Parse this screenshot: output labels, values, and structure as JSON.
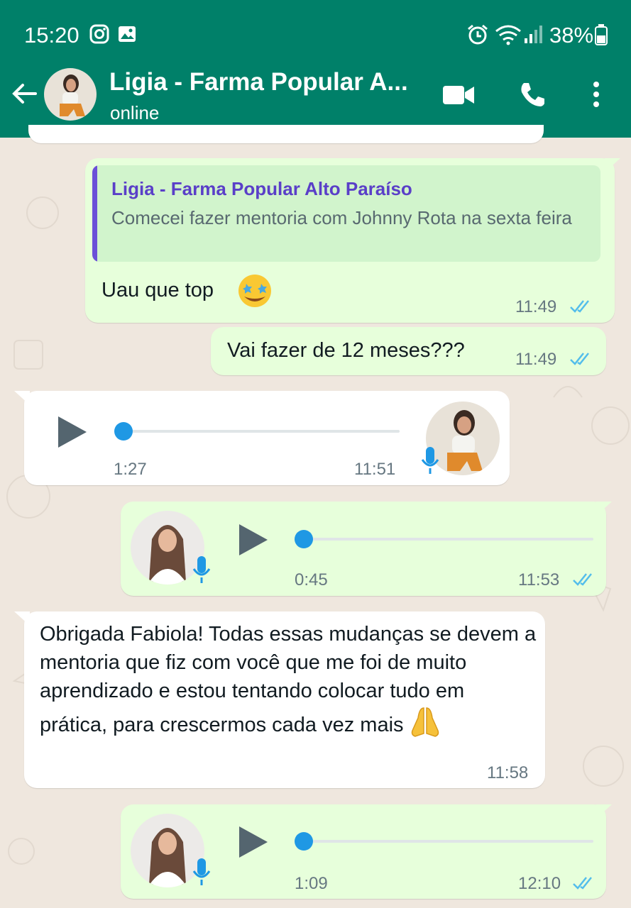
{
  "status_bar": {
    "time": "15:20",
    "battery": "38%"
  },
  "header": {
    "contact_name": "Ligia - Farma Popular A...",
    "contact_status": "online"
  },
  "messages": {
    "m1": {
      "quoted_name": "Ligia - Farma Popular Alto Paraíso",
      "quoted_text": "Comecei fazer mentoria com Johnny Rota na sexta feira",
      "text": "Uau que top",
      "emoji": "star-struck",
      "time": "11:49",
      "status": "read"
    },
    "m2": {
      "text": "Vai fazer de 12 meses???",
      "time": "11:49",
      "status": "read"
    },
    "m3": {
      "type": "voice",
      "direction": "incoming",
      "duration": "1:27",
      "time": "11:51",
      "progress": 0
    },
    "m4": {
      "type": "voice",
      "direction": "outgoing",
      "duration": "0:45",
      "time": "11:53",
      "status": "read",
      "progress": 0
    },
    "m5": {
      "text": "Obrigada Fabiola! Todas essas mudanças se devem a mentoria que fiz com você que me foi de muito aprendizado e estou tentando colocar tudo em prática, para crescermos cada vez mais",
      "emoji": "folded-hands",
      "time": "11:58"
    },
    "m6": {
      "type": "voice",
      "direction": "outgoing",
      "duration": "1:09",
      "time": "12:10",
      "status": "read",
      "progress": 0
    }
  },
  "colors": {
    "header": "#008069",
    "outgoing_bubble": "#e7ffdb",
    "incoming_bubble": "#ffffff",
    "read_ticks": "#53bdeb",
    "voice_dot": "#1f98e4"
  }
}
